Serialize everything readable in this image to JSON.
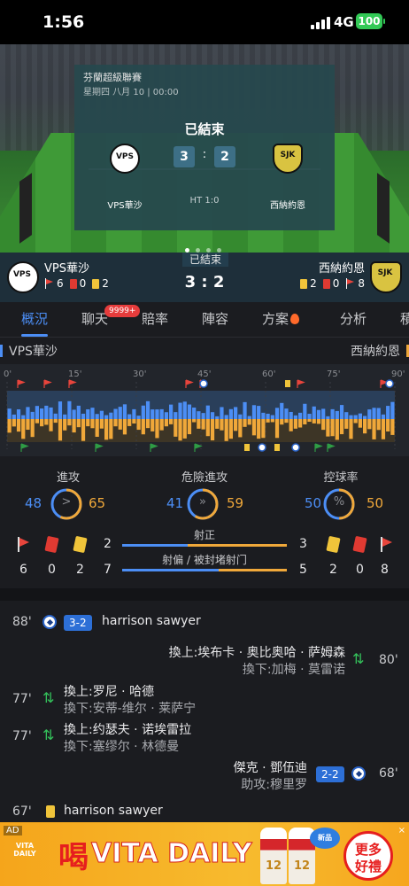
{
  "status_bar": {
    "time": "1:56",
    "network": "4G",
    "battery": "100"
  },
  "hero": {
    "league": "芬蘭超級聯賽",
    "datetime": "星期四 八月 10 | 00:00",
    "status": "已結束",
    "home_name": "VPS華沙",
    "away_name": "西納約恩",
    "home_score": "3",
    "away_score": "2",
    "colon": ":",
    "halftime": "HT 1:0"
  },
  "strip": {
    "status": "已結束",
    "home_name": "VPS華沙",
    "away_name": "西納約恩",
    "score": "3 : 2",
    "home_corners": "6",
    "home_red": "0",
    "home_yellow": "2",
    "away_yellow": "2",
    "away_red": "0",
    "away_corners": "8"
  },
  "tabs": [
    {
      "label": "概況"
    },
    {
      "label": "聊天",
      "badge": "9999+"
    },
    {
      "label": "賠率"
    },
    {
      "label": "陣容"
    },
    {
      "label": "方案"
    },
    {
      "label": "分析"
    },
    {
      "label": "積"
    }
  ],
  "timeline": {
    "home": "VPS華沙",
    "away": "西納約恩",
    "ticks": [
      "0'",
      "15'",
      "30'",
      "45'",
      "60'",
      "75'",
      "90'"
    ]
  },
  "stats": {
    "attack": {
      "title": "進攻",
      "home": "48",
      "away": "65",
      "glyph": ">"
    },
    "danger": {
      "title": "危險進攻",
      "home": "41",
      "away": "59",
      "glyph": "»"
    },
    "possession": {
      "title": "控球率",
      "home": "50",
      "away": "50",
      "glyph": "%"
    },
    "shots_on": {
      "title": "射正",
      "home": 2,
      "away": 3
    },
    "shots_off": {
      "title": "射偏 / 被封堵射门",
      "home": 7,
      "away": 5
    },
    "home_corners": "6",
    "home_red": "0",
    "home_yellow": "2",
    "away_yellow": "2",
    "away_red": "0",
    "away_corners": "8"
  },
  "events": [
    {
      "minute": "88'",
      "score": "3-2",
      "player": "harrison sawyer"
    },
    {
      "minute": "80'",
      "in": "換上:埃布卡 · 奥比奥哈 · 萨姆森",
      "out": "換下:加梅 · 莫雷诺"
    },
    {
      "minute": "77'",
      "in": "換上:罗尼 · 哈德",
      "out": "換下:安蒂-维尔 · 莱萨宁"
    },
    {
      "minute": "77'",
      "in": "換上:约瑟夫 · 诺埃雷拉",
      "out": "換下:塞缪尔 · 林德曼"
    },
    {
      "minute": "68'",
      "score": "2-2",
      "player": "傑克 · 鄧伍迪",
      "assist": "助攻:穆里罗"
    },
    {
      "minute": "67'",
      "player": "harrison sawyer"
    }
  ],
  "ad": {
    "label": "AD",
    "logo": "VITA DAILY",
    "drink": "喝",
    "brand": "VITA DAILY",
    "bubble": "新品",
    "cta_line1": "更多",
    "cta_line2": "好禮",
    "close": "×"
  },
  "colors": {
    "home": "#4c8ef5",
    "away": "#f0a83a",
    "accent": "#4c8ef5"
  }
}
